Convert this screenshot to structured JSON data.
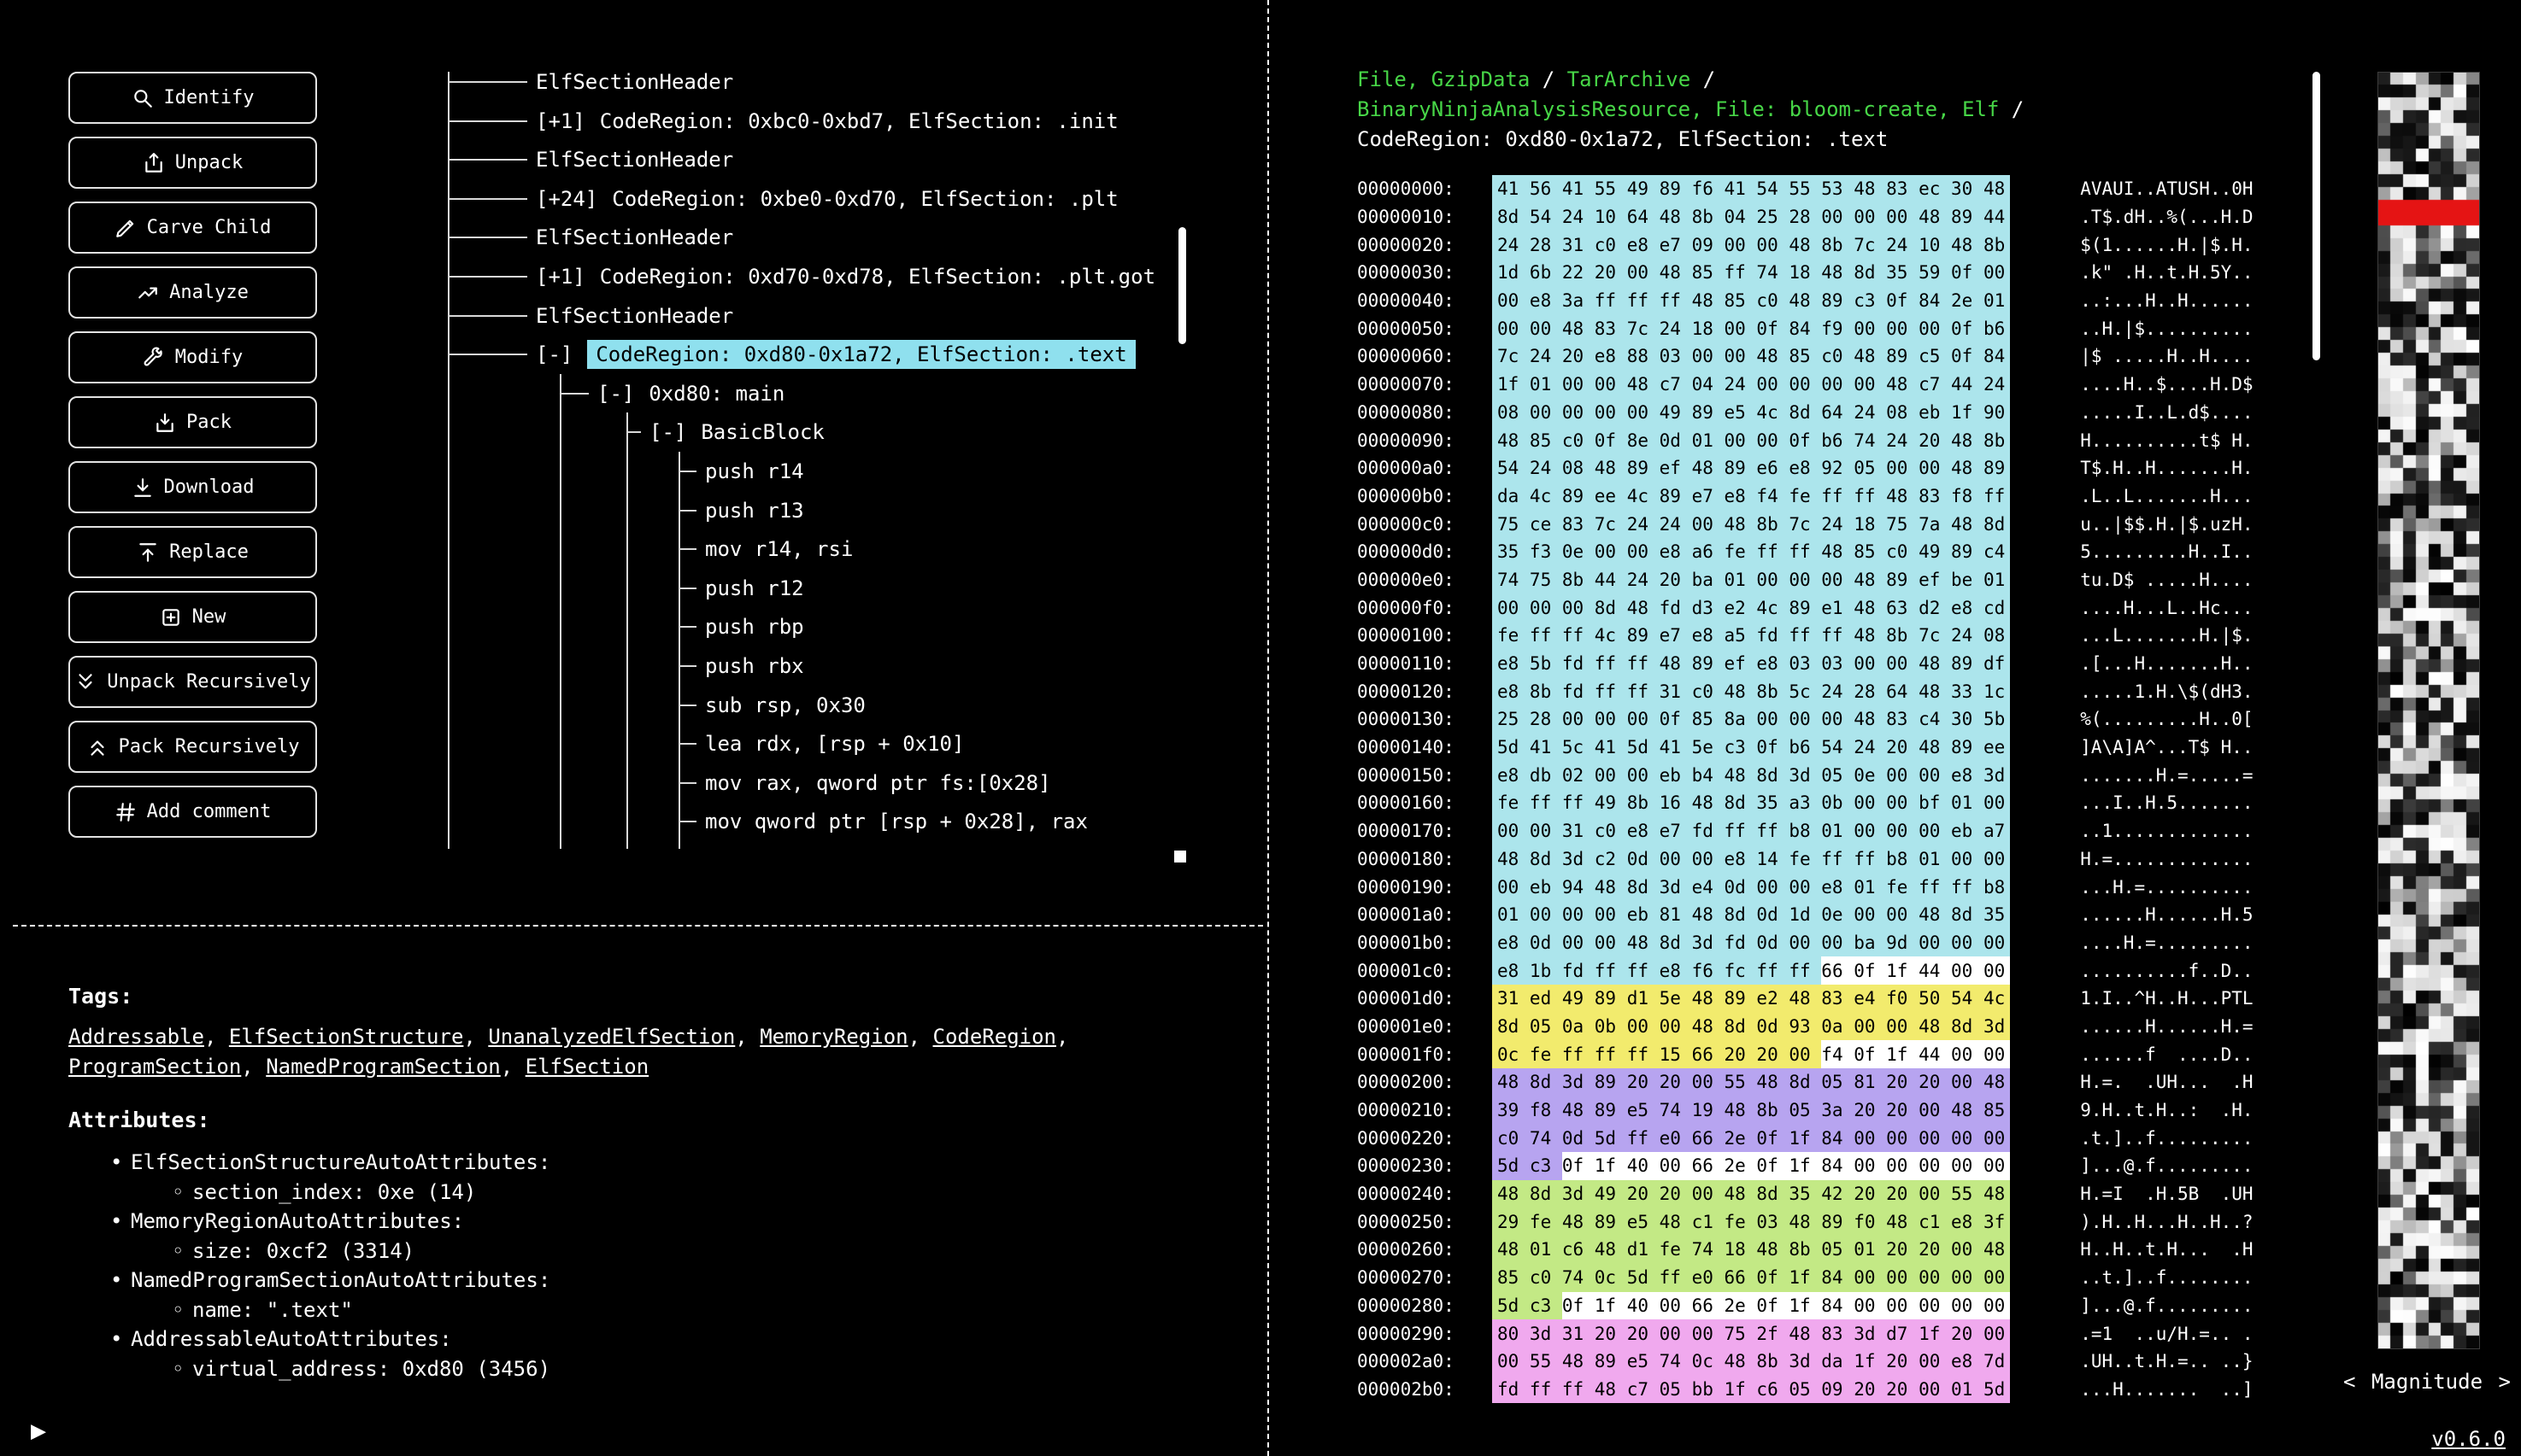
{
  "meta": {
    "version_label": "v0.6.0",
    "play_icon": "▶"
  },
  "colors": {
    "selection": "#8fe0ee",
    "hex_cyan": "#ace5ec",
    "hex_yellow": "#f2eb6d",
    "hex_purple": "#b7a4f0",
    "hex_green": "#c3e985",
    "hex_pink": "#f0a9ee",
    "hex_white": "#ffffff",
    "breadcrumb_green": "#47d647",
    "entropy_red": "#e51414"
  },
  "toolbar": {
    "buttons": [
      {
        "label": "Identify",
        "icon": "magnifier-icon"
      },
      {
        "label": "Unpack",
        "icon": "unpack-icon"
      },
      {
        "label": "Carve Child",
        "icon": "pencil-icon"
      },
      {
        "label": "Analyze",
        "icon": "trend-icon"
      },
      {
        "label": "Modify",
        "icon": "wrench-icon"
      },
      {
        "label": "Pack",
        "icon": "pack-icon"
      },
      {
        "label": "Download",
        "icon": "download-icon"
      },
      {
        "label": "Replace",
        "icon": "upload-icon"
      },
      {
        "label": "New",
        "icon": "new-icon"
      },
      {
        "label": "Unpack Recursively",
        "icon": "unpack-recursive-icon"
      },
      {
        "label": "Pack Recursively",
        "icon": "pack-recursive-icon"
      },
      {
        "label": "Add comment",
        "icon": "comment-icon"
      }
    ]
  },
  "tree": {
    "rows": [
      {
        "level": 0,
        "expand": "",
        "label": "ElfSectionHeader"
      },
      {
        "level": 0,
        "expand": "[+1]",
        "label": "CodeRegion: 0xbc0-0xbd7, ElfSection: .init"
      },
      {
        "level": 0,
        "expand": "",
        "label": "ElfSectionHeader"
      },
      {
        "level": 0,
        "expand": "[+24]",
        "label": "CodeRegion: 0xbe0-0xd70, ElfSection: .plt"
      },
      {
        "level": 0,
        "expand": "",
        "label": "ElfSectionHeader"
      },
      {
        "level": 0,
        "expand": "[+1]",
        "label": "CodeRegion: 0xd70-0xd78, ElfSection: .plt.got"
      },
      {
        "level": 0,
        "expand": "",
        "label": "ElfSectionHeader"
      },
      {
        "level": 0,
        "expand": "[-]",
        "label": "CodeRegion: 0xd80-0x1a72, ElfSection: .text",
        "selected": true
      },
      {
        "level": 1,
        "expand": "[-]",
        "label": "0xd80: main"
      },
      {
        "level": 2,
        "expand": "[-]",
        "label": "BasicBlock"
      },
      {
        "level": 3,
        "expand": "",
        "label": "push r14"
      },
      {
        "level": 3,
        "expand": "",
        "label": "push r13"
      },
      {
        "level": 3,
        "expand": "",
        "label": "mov r14, rsi"
      },
      {
        "level": 3,
        "expand": "",
        "label": "push r12"
      },
      {
        "level": 3,
        "expand": "",
        "label": "push rbp"
      },
      {
        "level": 3,
        "expand": "",
        "label": "push rbx"
      },
      {
        "level": 3,
        "expand": "",
        "label": "sub rsp, 0x30"
      },
      {
        "level": 3,
        "expand": "",
        "label": "lea rdx, [rsp + 0x10]"
      },
      {
        "level": 3,
        "expand": "",
        "label": "mov rax, qword ptr fs:[0x28]"
      },
      {
        "level": 3,
        "expand": "",
        "label": "mov qword ptr [rsp + 0x28], rax"
      }
    ]
  },
  "tags": {
    "heading": "Tags:",
    "items": [
      "Addressable",
      "ElfSectionStructure",
      "UnanalyzedElfSection",
      "MemoryRegion",
      "CodeRegion",
      "ProgramSection",
      "NamedProgramSection",
      "ElfSection"
    ]
  },
  "attributes": {
    "heading": "Attributes:",
    "groups": [
      {
        "name": "ElfSectionStructureAutoAttributes:",
        "entries": [
          "section_index: 0xe (14)"
        ]
      },
      {
        "name": "MemoryRegionAutoAttributes:",
        "entries": [
          "size: 0xcf2 (3314)"
        ]
      },
      {
        "name": "NamedProgramSectionAutoAttributes:",
        "entries": [
          "name: \".text\""
        ]
      },
      {
        "name": "AddressableAutoAttributes:",
        "entries": [
          "virtual_address: 0xd80 (3456)"
        ]
      }
    ]
  },
  "breadcrumb": {
    "lines": [
      [
        {
          "text": "File, GzipData",
          "link": true
        },
        {
          "text": " / ",
          "link": false
        },
        {
          "text": "TarArchive",
          "link": true
        },
        {
          "text": " /",
          "link": false
        }
      ],
      [
        {
          "text": "BinaryNinjaAnalysisResource, File: bloom-create, Elf",
          "link": true
        },
        {
          "text": " /",
          "link": false
        }
      ],
      [
        {
          "text": "CodeRegion: 0xd80-0x1a72, ElfSection: .text",
          "link": false
        }
      ]
    ]
  },
  "hex_view": {
    "rows": [
      {
        "addr": "00000000:",
        "segs": [
          [
            "cyan",
            "41 56 41 55 49 89 f6 41 54 55 53 48 83 ec 30 48"
          ]
        ]
      },
      {
        "addr": "00000010:",
        "segs": [
          [
            "cyan",
            "8d 54 24 10 64 48 8b 04 25 28 00 00 00 48 89 44"
          ]
        ]
      },
      {
        "addr": "00000020:",
        "segs": [
          [
            "cyan",
            "24 28 31 c0 e8 e7 09 00 00 48 8b 7c 24 10 48 8b"
          ]
        ]
      },
      {
        "addr": "00000030:",
        "segs": [
          [
            "cyan",
            "1d 6b 22 20 00 48 85 ff 74 18 48 8d 35 59 0f 00"
          ]
        ]
      },
      {
        "addr": "00000040:",
        "segs": [
          [
            "cyan",
            "00 e8 3a ff ff ff 48 85 c0 48 89 c3 0f 84 2e 01"
          ]
        ]
      },
      {
        "addr": "00000050:",
        "segs": [
          [
            "cyan",
            "00 00 48 83 7c 24 18 00 0f 84 f9 00 00 00 0f b6"
          ]
        ]
      },
      {
        "addr": "00000060:",
        "segs": [
          [
            "cyan",
            "7c 24 20 e8 88 03 00 00 48 85 c0 48 89 c5 0f 84"
          ]
        ]
      },
      {
        "addr": "00000070:",
        "segs": [
          [
            "cyan",
            "1f 01 00 00 48 c7 04 24 00 00 00 00 48 c7 44 24"
          ]
        ]
      },
      {
        "addr": "00000080:",
        "segs": [
          [
            "cyan",
            "08 00 00 00 00 49 89 e5 4c 8d 64 24 08 eb 1f 90"
          ]
        ]
      },
      {
        "addr": "00000090:",
        "segs": [
          [
            "cyan",
            "48 85 c0 0f 8e 0d 01 00 00 0f b6 74 24 20 48 8b"
          ]
        ]
      },
      {
        "addr": "000000a0:",
        "segs": [
          [
            "cyan",
            "54 24 08 48 89 ef 48 89 e6 e8 92 05 00 00 48 89"
          ]
        ]
      },
      {
        "addr": "000000b0:",
        "segs": [
          [
            "cyan",
            "da 4c 89 ee 4c 89 e7 e8 f4 fe ff ff 48 83 f8 ff"
          ]
        ]
      },
      {
        "addr": "000000c0:",
        "segs": [
          [
            "cyan",
            "75 ce 83 7c 24 24 00 48 8b 7c 24 18 75 7a 48 8d"
          ]
        ]
      },
      {
        "addr": "000000d0:",
        "segs": [
          [
            "cyan",
            "35 f3 0e 00 00 e8 a6 fe ff ff 48 85 c0 49 89 c4"
          ]
        ]
      },
      {
        "addr": "000000e0:",
        "segs": [
          [
            "cyan",
            "74 75 8b 44 24 20 ba 01 00 00 00 48 89 ef be 01"
          ]
        ]
      },
      {
        "addr": "000000f0:",
        "segs": [
          [
            "cyan",
            "00 00 00 8d 48 fd d3 e2 4c 89 e1 48 63 d2 e8 cd"
          ]
        ]
      },
      {
        "addr": "00000100:",
        "segs": [
          [
            "cyan",
            "fe ff ff 4c 89 e7 e8 a5 fd ff ff 48 8b 7c 24 08"
          ]
        ]
      },
      {
        "addr": "00000110:",
        "segs": [
          [
            "cyan",
            "e8 5b fd ff ff 48 89 ef e8 03 03 00 00 48 89 df"
          ]
        ]
      },
      {
        "addr": "00000120:",
        "segs": [
          [
            "cyan",
            "e8 8b fd ff ff 31 c0 48 8b 5c 24 28 64 48 33 1c"
          ]
        ]
      },
      {
        "addr": "00000130:",
        "segs": [
          [
            "cyan",
            "25 28 00 00 00 0f 85 8a 00 00 00 48 83 c4 30 5b"
          ]
        ]
      },
      {
        "addr": "00000140:",
        "segs": [
          [
            "cyan",
            "5d 41 5c 41 5d 41 5e c3 0f b6 54 24 20 48 89 ee"
          ]
        ]
      },
      {
        "addr": "00000150:",
        "segs": [
          [
            "cyan",
            "e8 db 02 00 00 eb b4 48 8d 3d 05 0e 00 00 e8 3d"
          ]
        ]
      },
      {
        "addr": "00000160:",
        "segs": [
          [
            "cyan",
            "fe ff ff 49 8b 16 48 8d 35 a3 0b 00 00 bf 01 00"
          ]
        ]
      },
      {
        "addr": "00000170:",
        "segs": [
          [
            "cyan",
            "00 00 31 c0 e8 e7 fd ff ff b8 01 00 00 00 eb a7"
          ]
        ]
      },
      {
        "addr": "00000180:",
        "segs": [
          [
            "cyan",
            "48 8d 3d c2 0d 00 00 e8 14 fe ff ff b8 01 00 00"
          ]
        ]
      },
      {
        "addr": "00000190:",
        "segs": [
          [
            "cyan",
            "00 eb 94 48 8d 3d e4 0d 00 00 e8 01 fe ff ff b8"
          ]
        ]
      },
      {
        "addr": "000001a0:",
        "segs": [
          [
            "cyan",
            "01 00 00 00 eb 81 48 8d 0d 1d 0e 00 00 48 8d 35"
          ]
        ]
      },
      {
        "addr": "000001b0:",
        "segs": [
          [
            "cyan",
            "e8 0d 00 00 48 8d 3d fd 0d 00 00 ba 9d 00 00 00"
          ]
        ]
      },
      {
        "addr": "000001c0:",
        "segs": [
          [
            "cyan",
            "e8 1b fd ff ff e8 f6 fc ff ff"
          ],
          [
            "white",
            "66 0f 1f 44 00 00"
          ]
        ]
      },
      {
        "addr": "000001d0:",
        "segs": [
          [
            "yellow",
            "31 ed 49 89 d1 5e 48 89 e2 48 83 e4 f0 50 54 4c"
          ]
        ]
      },
      {
        "addr": "000001e0:",
        "segs": [
          [
            "yellow",
            "8d 05 0a 0b 00 00 48 8d 0d 93 0a 00 00 48 8d 3d"
          ]
        ]
      },
      {
        "addr": "000001f0:",
        "segs": [
          [
            "yellow",
            "0c fe ff ff ff 15 66 20 20 00"
          ],
          [
            "white",
            "f4 0f 1f 44 00 00"
          ]
        ]
      },
      {
        "addr": "00000200:",
        "segs": [
          [
            "purple",
            "48 8d 3d 89 20 20 00 55 48 8d 05 81 20 20 00 48"
          ]
        ]
      },
      {
        "addr": "00000210:",
        "segs": [
          [
            "purple",
            "39 f8 48 89 e5 74 19 48 8b 05 3a 20 20 00 48 85"
          ]
        ]
      },
      {
        "addr": "00000220:",
        "segs": [
          [
            "purple",
            "c0 74 0d 5d ff e0 66 2e 0f 1f 84 00 00 00 00 00"
          ]
        ]
      },
      {
        "addr": "00000230:",
        "segs": [
          [
            "purple",
            "5d c3"
          ],
          [
            "white",
            "0f 1f 40 00 66 2e 0f 1f 84 00 00 00 00 00"
          ]
        ]
      },
      {
        "addr": "00000240:",
        "segs": [
          [
            "green",
            "48 8d 3d 49 20 20 00 48 8d 35 42 20 20 00 55 48"
          ]
        ]
      },
      {
        "addr": "00000250:",
        "segs": [
          [
            "green",
            "29 fe 48 89 e5 48 c1 fe 03 48 89 f0 48 c1 e8 3f"
          ]
        ]
      },
      {
        "addr": "00000260:",
        "segs": [
          [
            "green",
            "48 01 c6 48 d1 fe 74 18 48 8b 05 01 20 20 00 48"
          ]
        ]
      },
      {
        "addr": "00000270:",
        "segs": [
          [
            "green",
            "85 c0 74 0c 5d ff e0 66 0f 1f 84 00 00 00 00 00"
          ]
        ]
      },
      {
        "addr": "00000280:",
        "segs": [
          [
            "green",
            "5d c3"
          ],
          [
            "white",
            "0f 1f 40 00 66 2e 0f 1f 84 00 00 00 00 00"
          ]
        ]
      },
      {
        "addr": "00000290:",
        "segs": [
          [
            "pink",
            "80 3d 31 20 20 00 00 75 2f 48 83 3d d7 1f 20 00"
          ]
        ]
      },
      {
        "addr": "000002a0:",
        "segs": [
          [
            "pink",
            "00 55 48 89 e5 74 0c 48 8b 3d da 1f 20 00 e8 7d"
          ]
        ]
      },
      {
        "addr": "000002b0:",
        "segs": [
          [
            "pink",
            "fd ff ff 48 c7 05 bb 1f c6 05 09 20 20 00 01 5d"
          ]
        ]
      }
    ]
  },
  "magnitude": {
    "prev": "<",
    "label": "Magnitude",
    "next": ">"
  }
}
